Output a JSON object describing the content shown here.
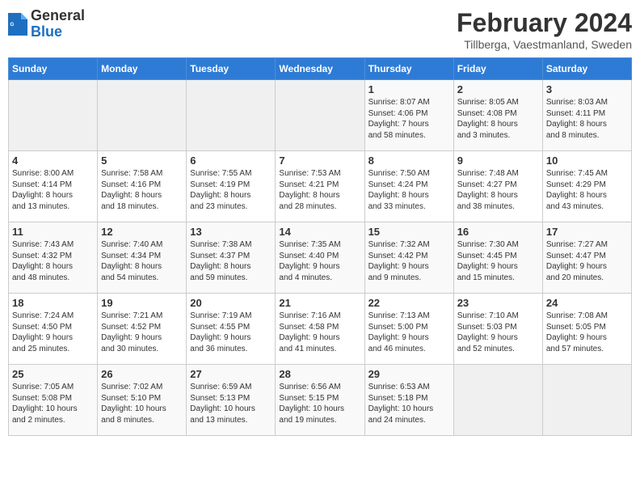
{
  "header": {
    "logo_general": "General",
    "logo_blue": "Blue",
    "month_title": "February 2024",
    "location": "Tillberga, Vaestmanland, Sweden"
  },
  "days_of_week": [
    "Sunday",
    "Monday",
    "Tuesday",
    "Wednesday",
    "Thursday",
    "Friday",
    "Saturday"
  ],
  "weeks": [
    [
      {
        "day": "",
        "content": ""
      },
      {
        "day": "",
        "content": ""
      },
      {
        "day": "",
        "content": ""
      },
      {
        "day": "",
        "content": ""
      },
      {
        "day": "1",
        "content": "Sunrise: 8:07 AM\nSunset: 4:06 PM\nDaylight: 7 hours\nand 58 minutes."
      },
      {
        "day": "2",
        "content": "Sunrise: 8:05 AM\nSunset: 4:08 PM\nDaylight: 8 hours\nand 3 minutes."
      },
      {
        "day": "3",
        "content": "Sunrise: 8:03 AM\nSunset: 4:11 PM\nDaylight: 8 hours\nand 8 minutes."
      }
    ],
    [
      {
        "day": "4",
        "content": "Sunrise: 8:00 AM\nSunset: 4:14 PM\nDaylight: 8 hours\nand 13 minutes."
      },
      {
        "day": "5",
        "content": "Sunrise: 7:58 AM\nSunset: 4:16 PM\nDaylight: 8 hours\nand 18 minutes."
      },
      {
        "day": "6",
        "content": "Sunrise: 7:55 AM\nSunset: 4:19 PM\nDaylight: 8 hours\nand 23 minutes."
      },
      {
        "day": "7",
        "content": "Sunrise: 7:53 AM\nSunset: 4:21 PM\nDaylight: 8 hours\nand 28 minutes."
      },
      {
        "day": "8",
        "content": "Sunrise: 7:50 AM\nSunset: 4:24 PM\nDaylight: 8 hours\nand 33 minutes."
      },
      {
        "day": "9",
        "content": "Sunrise: 7:48 AM\nSunset: 4:27 PM\nDaylight: 8 hours\nand 38 minutes."
      },
      {
        "day": "10",
        "content": "Sunrise: 7:45 AM\nSunset: 4:29 PM\nDaylight: 8 hours\nand 43 minutes."
      }
    ],
    [
      {
        "day": "11",
        "content": "Sunrise: 7:43 AM\nSunset: 4:32 PM\nDaylight: 8 hours\nand 48 minutes."
      },
      {
        "day": "12",
        "content": "Sunrise: 7:40 AM\nSunset: 4:34 PM\nDaylight: 8 hours\nand 54 minutes."
      },
      {
        "day": "13",
        "content": "Sunrise: 7:38 AM\nSunset: 4:37 PM\nDaylight: 8 hours\nand 59 minutes."
      },
      {
        "day": "14",
        "content": "Sunrise: 7:35 AM\nSunset: 4:40 PM\nDaylight: 9 hours\nand 4 minutes."
      },
      {
        "day": "15",
        "content": "Sunrise: 7:32 AM\nSunset: 4:42 PM\nDaylight: 9 hours\nand 9 minutes."
      },
      {
        "day": "16",
        "content": "Sunrise: 7:30 AM\nSunset: 4:45 PM\nDaylight: 9 hours\nand 15 minutes."
      },
      {
        "day": "17",
        "content": "Sunrise: 7:27 AM\nSunset: 4:47 PM\nDaylight: 9 hours\nand 20 minutes."
      }
    ],
    [
      {
        "day": "18",
        "content": "Sunrise: 7:24 AM\nSunset: 4:50 PM\nDaylight: 9 hours\nand 25 minutes."
      },
      {
        "day": "19",
        "content": "Sunrise: 7:21 AM\nSunset: 4:52 PM\nDaylight: 9 hours\nand 30 minutes."
      },
      {
        "day": "20",
        "content": "Sunrise: 7:19 AM\nSunset: 4:55 PM\nDaylight: 9 hours\nand 36 minutes."
      },
      {
        "day": "21",
        "content": "Sunrise: 7:16 AM\nSunset: 4:58 PM\nDaylight: 9 hours\nand 41 minutes."
      },
      {
        "day": "22",
        "content": "Sunrise: 7:13 AM\nSunset: 5:00 PM\nDaylight: 9 hours\nand 46 minutes."
      },
      {
        "day": "23",
        "content": "Sunrise: 7:10 AM\nSunset: 5:03 PM\nDaylight: 9 hours\nand 52 minutes."
      },
      {
        "day": "24",
        "content": "Sunrise: 7:08 AM\nSunset: 5:05 PM\nDaylight: 9 hours\nand 57 minutes."
      }
    ],
    [
      {
        "day": "25",
        "content": "Sunrise: 7:05 AM\nSunset: 5:08 PM\nDaylight: 10 hours\nand 2 minutes."
      },
      {
        "day": "26",
        "content": "Sunrise: 7:02 AM\nSunset: 5:10 PM\nDaylight: 10 hours\nand 8 minutes."
      },
      {
        "day": "27",
        "content": "Sunrise: 6:59 AM\nSunset: 5:13 PM\nDaylight: 10 hours\nand 13 minutes."
      },
      {
        "day": "28",
        "content": "Sunrise: 6:56 AM\nSunset: 5:15 PM\nDaylight: 10 hours\nand 19 minutes."
      },
      {
        "day": "29",
        "content": "Sunrise: 6:53 AM\nSunset: 5:18 PM\nDaylight: 10 hours\nand 24 minutes."
      },
      {
        "day": "",
        "content": ""
      },
      {
        "day": "",
        "content": ""
      }
    ]
  ]
}
